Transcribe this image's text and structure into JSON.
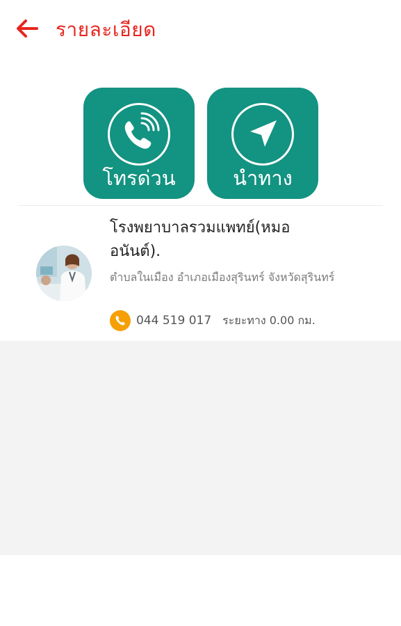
{
  "header": {
    "back_icon": "arrow-left-icon",
    "title": "รายละเอียด",
    "accent_color": "#e8251e"
  },
  "actions": {
    "tile_color": "#139381",
    "call": {
      "label": "โทรด่วน",
      "icon": "phone-ringing-icon"
    },
    "navigate": {
      "label": "นำทาง",
      "icon": "navigation-arrow-icon"
    }
  },
  "place": {
    "name": "โรงพยาบาลรวมแพทย์(หมออนันต์).",
    "address": "ตำบลในเมือง อำเภอเมืองสุรินทร์ จังหวัดสุรินทร์",
    "phone": "044 519 017",
    "distance": "ระยะทาง 0.00 กม.",
    "avatar_icon": "doctor-photo-avatar",
    "phone_icon": "phone-icon",
    "phone_icon_color": "#f5a000"
  }
}
